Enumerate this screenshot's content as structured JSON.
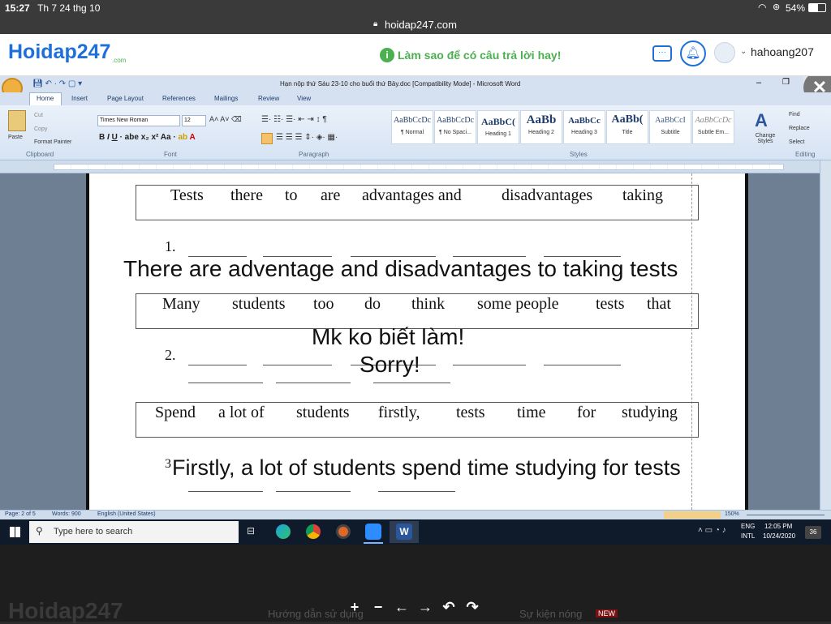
{
  "ios_status": {
    "time": "15:27",
    "date": "Th 7 24 thg 10",
    "battery": "54%"
  },
  "browser": {
    "url": "hoidap247.com"
  },
  "site": {
    "logo_main": "Hoidap247",
    "logo_sub": ".com",
    "tip_text": "Làm sao để có câu trả lời hay!",
    "username": "hahoang207"
  },
  "word": {
    "title": "Hạn nộp thứ Sáu 23-10 cho buổi thứ Bảy.doc [Compatibility Mode] - Microsoft Word",
    "tabs": [
      "Home",
      "Insert",
      "Page Layout",
      "References",
      "Mailings",
      "Review",
      "View"
    ],
    "clipboard": {
      "paste": "Paste",
      "cut": "Cut",
      "copy": "Copy",
      "format_painter": "Format Painter",
      "group": "Clipboard"
    },
    "font": {
      "name": "Times New Roman",
      "size": "12",
      "group": "Font"
    },
    "paragraph_group": "Paragraph",
    "styles": [
      {
        "sample": "AaBbCcDc",
        "label": "¶ Normal"
      },
      {
        "sample": "AaBbCcDc",
        "label": "¶ No Spaci..."
      },
      {
        "sample": "AaBbC(",
        "label": "Heading 1"
      },
      {
        "sample": "AaBb",
        "label": "Heading 2"
      },
      {
        "sample": "AaBbCc",
        "label": "Heading 3"
      },
      {
        "sample": "AaBb(",
        "label": "Title"
      },
      {
        "sample": "AaBbCcI",
        "label": "Subtitle"
      },
      {
        "sample": "AaBbCcDc",
        "label": "Subtle Em..."
      }
    ],
    "styles_group": "Styles",
    "change_styles": "Change Styles",
    "editing": {
      "find": "Find",
      "replace": "Replace",
      "select": "Select",
      "group": "Editing"
    },
    "status": {
      "page": "Page: 2 of 5",
      "words": "Words: 900",
      "language": "English (United States)",
      "zoom": "150%"
    }
  },
  "document": {
    "q1_words": [
      "Tests",
      "there",
      "to",
      "are",
      "advantages and",
      "disadvantages",
      "taking"
    ],
    "q1_number": "1.",
    "q1_answer": "There are adventage and disadvantages to taking tests",
    "q2_words": [
      "Many",
      "students",
      "too",
      "do",
      "think",
      "some people",
      "tests",
      "that"
    ],
    "q2_number": "2.",
    "q2_answer_line1": "Mk ko biết làm!",
    "q2_answer_line2": "Sorry!",
    "q3_words": [
      "Spend",
      "a lot of",
      "students",
      "firstly,",
      "tests",
      "time",
      "for",
      "studying"
    ],
    "q3_number": "3",
    "q3_answer": "Firstly, a lot of students spend time studying for tests"
  },
  "taskbar": {
    "search_placeholder": "Type here to search",
    "lang1": "ENG",
    "lang2": "INTL",
    "time": "12:05 PM",
    "date": "10/24/2020",
    "notifications": "36"
  },
  "bottom": {
    "logo_faded": "Hoidap247",
    "link1": "Hướng dẫn sử dụng",
    "link2": "Sự kiện nóng",
    "badge": "NEW"
  },
  "colors": {
    "brand_blue": "#1e6fd9",
    "brand_green": "#4caf50",
    "word_blue": "#2b579a"
  }
}
